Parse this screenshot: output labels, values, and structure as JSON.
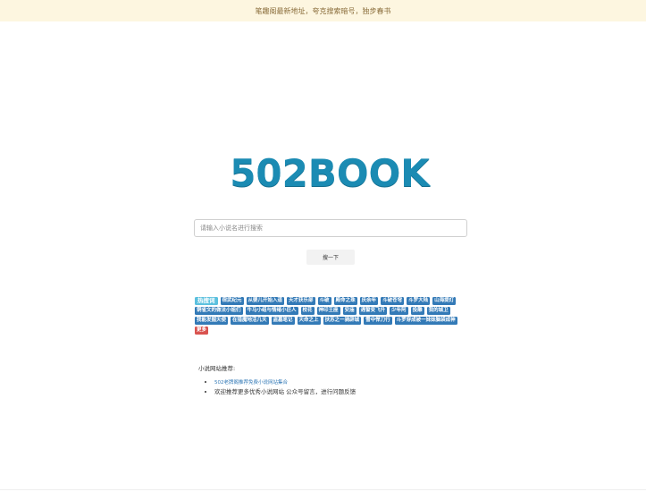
{
  "notice": {
    "text": "笔趣阁最新地址，夸克搜索暗号，独步春书"
  },
  "logo": {
    "text": "502BOOK",
    "color": "#1b8bb3"
  },
  "search": {
    "placeholder": "请输入小说名进行搜索",
    "value": "",
    "button_label": "搜一下"
  },
  "tags": {
    "hot_label": "热搜词",
    "items": [
      "宿武纪元",
      "从婴儿开始入道",
      "天才获乐部",
      "斗破",
      "殿命之珠",
      "庆余年",
      "斗破苍穹",
      "斗罗大陆",
      "山海提灯",
      "铜雀文的做法小姐们",
      "牛马小组与情绪小巨人",
      "校花",
      "神印王座",
      "安庙",
      "遇誓变飞升",
      "少年阿",
      "投雕",
      "我的城卫",
      "我能发掘天使",
      "在猎魔地活几天",
      "盗墓笔记",
      "天命之上",
      "扶苏之一骑辟城",
      "雪中悍刀行",
      "斗罗穿成被一妹妹脑袋成神"
    ],
    "more_label": "更多",
    "colors": {
      "tag": "#337ab7",
      "hot": "#5bc0de",
      "more": "#d9534f"
    }
  },
  "recommend": {
    "title": "小说网站推荐:",
    "items": [
      {
        "text": "502老牌阁推荐免费小说网站集合",
        "is_link": true
      },
      {
        "text": "欢迎推荐更多优秀小说网站 公众号留言，进行问题反馈",
        "is_link": false
      }
    ]
  }
}
